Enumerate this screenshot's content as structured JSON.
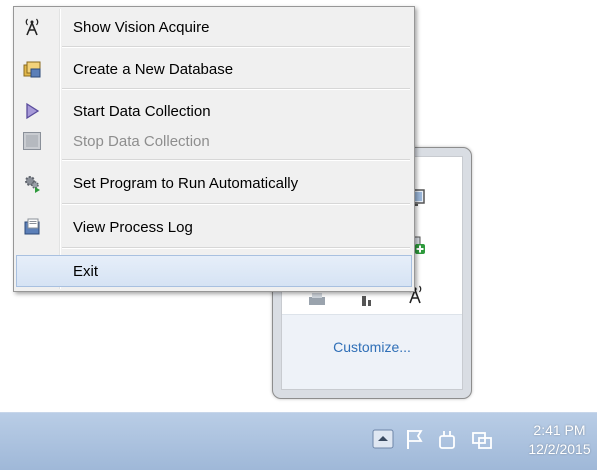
{
  "menu": {
    "items": [
      {
        "label": "Show Vision Acquire",
        "icon": "antenna-icon",
        "enabled": true
      },
      {
        "label": "Create a New Database",
        "icon": "database-icon",
        "enabled": true
      },
      {
        "label": "Start Data Collection",
        "icon": "play-icon",
        "enabled": true
      },
      {
        "label": "Stop Data Collection",
        "icon": "stop-icon",
        "enabled": false
      },
      {
        "label": "Set Program to Run Automatically",
        "icon": "gears-icon",
        "enabled": true
      },
      {
        "label": "View Process Log",
        "icon": "log-icon",
        "enabled": true
      },
      {
        "label": "Exit",
        "icon": "",
        "enabled": true,
        "highlighted": true
      }
    ]
  },
  "tray_overflow": {
    "customize_label": "Customize...",
    "icons": [
      "monitor-icon",
      "add-device-icon",
      "printer-icon",
      "network-icon",
      "antenna-icon"
    ]
  },
  "taskbar": {
    "clock_time": "2:41 PM",
    "clock_date": "12/2/2015",
    "icons": [
      "show-hidden-icons-button",
      "action-center-flag-icon",
      "power-icon",
      "network-icon"
    ]
  },
  "colors": {
    "taskbar": "#a9c1df",
    "menu_highlight": "#d6e3f4",
    "link": "#2f6fb7"
  }
}
